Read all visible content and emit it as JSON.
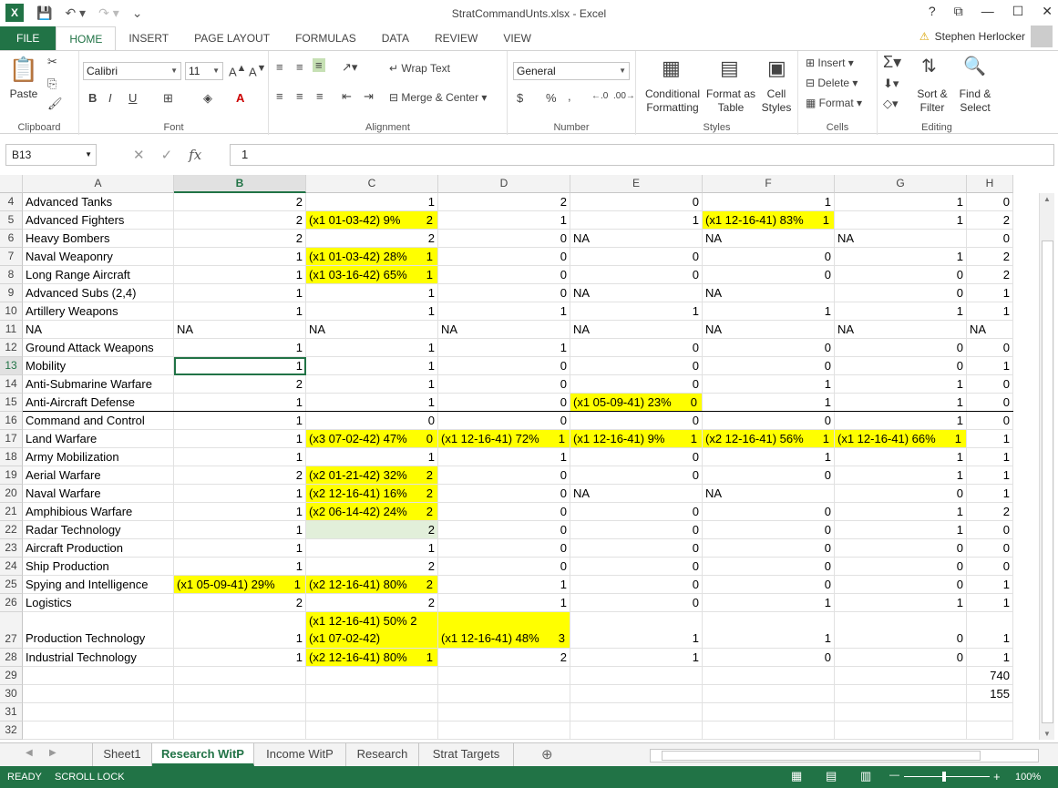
{
  "app": {
    "title": "StratCommandUnts.xlsx - Excel",
    "logo": "X",
    "user": "Stephen Herlocker",
    "window_buttons": [
      "?",
      "⧉",
      "—",
      "☐",
      "✕"
    ]
  },
  "ribbon_tabs": [
    "FILE",
    "HOME",
    "INSERT",
    "PAGE LAYOUT",
    "FORMULAS",
    "DATA",
    "REVIEW",
    "VIEW"
  ],
  "ribbon": {
    "clipboard": {
      "paste": "Paste",
      "label": "Clipboard"
    },
    "font": {
      "name": "Calibri",
      "size": "11",
      "label": "Font",
      "bold": "B",
      "italic": "I",
      "underline": "U"
    },
    "alignment": {
      "wrap": "Wrap Text",
      "merge": "Merge & Center",
      "label": "Alignment"
    },
    "number": {
      "format": "General",
      "label": "Number",
      "currency": "$",
      "percent": "%",
      "comma": ","
    },
    "styles": {
      "conditional": "Conditional Formatting",
      "format_table": "Format as Table",
      "cell_styles": "Cell Styles",
      "label": "Styles"
    },
    "cells": {
      "insert": "Insert",
      "delete": "Delete",
      "format": "Format",
      "label": "Cells"
    },
    "editing": {
      "sort": "Sort & Filter",
      "find": "Find & Select",
      "label": "Editing"
    }
  },
  "formula_bar": {
    "name_box": "B13",
    "fx": "fx",
    "value": "1"
  },
  "columns": [
    "A",
    "B",
    "C",
    "D",
    "E",
    "F",
    "G",
    "H"
  ],
  "selected_column": "B",
  "selected_row": "13",
  "rows": [
    {
      "n": "4",
      "A": "Advanced Tanks",
      "B": "2",
      "C": "1",
      "D": "2",
      "E": "0",
      "F": "1",
      "G": "1",
      "H": "0"
    },
    {
      "n": "5",
      "A": "Advanced Fighters",
      "B": "2",
      "C": "(x1 01-03-42)    9%    2",
      "D": "1",
      "E": "1",
      "F": "(x1 12-16-41)   83%    1",
      "G": "1",
      "H": "2"
    },
    {
      "n": "6",
      "A": "Heavy Bombers",
      "B": "2",
      "C": "2",
      "D": "0",
      "E": "NA",
      "F": "NA",
      "G": "NA",
      "H": "0"
    },
    {
      "n": "7",
      "A": "Naval Weaponry",
      "B": "1",
      "C": "(x1 01-03-42)   28%    1",
      "D": "0",
      "E": "0",
      "F": "0",
      "G": "1",
      "H": "2"
    },
    {
      "n": "8",
      "A": "Long Range Aircraft",
      "B": "1",
      "C": "(x1 03-16-42)   65%    1",
      "D": "0",
      "E": "0",
      "F": "0",
      "G": "0",
      "H": "2"
    },
    {
      "n": "9",
      "A": "Advanced Subs (2,4)",
      "B": "1",
      "C": "1",
      "D": "0",
      "E": "NA",
      "F": "NA",
      "G": "0",
      "H": "1"
    },
    {
      "n": "10",
      "A": "Artillery Weapons",
      "B": "1",
      "C": "1",
      "D": "1",
      "E": "1",
      "F": "1",
      "G": "1",
      "H": "1"
    },
    {
      "n": "11",
      "A": "NA",
      "B": "NA",
      "C": "NA",
      "D": "NA",
      "E": "NA",
      "F": "NA",
      "G": "NA",
      "H": "NA"
    },
    {
      "n": "12",
      "A": "Ground Attack Weapons",
      "B": "1",
      "C": "1",
      "D": "1",
      "E": "0",
      "F": "0",
      "G": "0",
      "H": "0"
    },
    {
      "n": "13",
      "A": "Mobility",
      "B": "1",
      "C": "1",
      "D": "0",
      "E": "0",
      "F": "0",
      "G": "0",
      "H": "1"
    },
    {
      "n": "14",
      "A": "Anti-Submarine Warfare",
      "B": "2",
      "C": "1",
      "D": "0",
      "E": "0",
      "F": "1",
      "G": "1",
      "H": "0"
    },
    {
      "n": "15",
      "A": "Anti-Aircraft Defense",
      "B": "1",
      "C": "1",
      "D": "0",
      "E": "(x1 05-09-41)    23%    0",
      "F": "1",
      "G": "1",
      "H": "0"
    },
    {
      "n": "16",
      "A": "Command and Control",
      "B": "1",
      "C": "0",
      "D": "0",
      "E": "0",
      "F": "0",
      "G": "1",
      "H": "0"
    },
    {
      "n": "17",
      "A": "Land Warfare",
      "B": "1",
      "C": "(x3 07-02-42)   47%    0",
      "D": "(x1 12-16-41)   72%    1",
      "E": "(x1 12-16-41)         9%    1",
      "F": "(x2 12-16-41)   56%    1",
      "G": "(x1 12-16-41)   66%    1",
      "H": "1"
    },
    {
      "n": "18",
      "A": "Army Mobilization",
      "B": "1",
      "C": "1",
      "D": "1",
      "E": "0",
      "F": "1",
      "G": "1",
      "H": "1"
    },
    {
      "n": "19",
      "A": "Aerial Warfare",
      "B": "2",
      "C": "(x2 01-21-42)  32%       2",
      "D": "0",
      "E": "0",
      "F": "0",
      "G": "1",
      "H": "1"
    },
    {
      "n": "20",
      "A": "Naval Warfare",
      "B": "1",
      "C": "(x2 12-16-41)  16%       2",
      "D": "0",
      "E": "NA",
      "F": "NA",
      "G": "0",
      "H": "1"
    },
    {
      "n": "21",
      "A": "Amphibious Warfare",
      "B": "1",
      "C": "(x2 06-14-42)   24%     2",
      "D": "0",
      "E": "0",
      "F": "0",
      "G": "1",
      "H": "2"
    },
    {
      "n": "22",
      "A": "Radar Technology",
      "B": "1",
      "C": "2",
      "D": "0",
      "E": "0",
      "F": "0",
      "G": "1",
      "H": "0"
    },
    {
      "n": "23",
      "A": "Aircraft Production",
      "B": "1",
      "C": "1",
      "D": "0",
      "E": "0",
      "F": "0",
      "G": "0",
      "H": "0"
    },
    {
      "n": "24",
      "A": "Ship Production",
      "B": "1",
      "C": "2",
      "D": "0",
      "E": "0",
      "F": "0",
      "G": "0",
      "H": "0"
    },
    {
      "n": "25",
      "A": "Spying and Intelligence",
      "B": "(x1 05-09-41)      29%    1",
      "C": "(x2 12-16-41)      80%    2",
      "D": "1",
      "E": "0",
      "F": "0",
      "G": "0",
      "H": "1"
    },
    {
      "n": "26",
      "A": "Logistics",
      "B": "2",
      "C": "2",
      "D": "1",
      "E": "0",
      "F": "1",
      "G": "1",
      "H": "1"
    },
    {
      "n": "27",
      "A": "Production Technology",
      "B": "1",
      "C": "(x1 12-16-41)   50%    2",
      "C2": "(x1 07-02-42)",
      "D": "(x1 12-16-41)   48%     3",
      "E": "1",
      "F": "1",
      "G": "0",
      "H": "1"
    },
    {
      "n": "28",
      "A": "Industrial Technology",
      "B": "1",
      "C": "(x2 12-16-41)   80%      1",
      "D": "2",
      "E": "1",
      "F": "0",
      "G": "0",
      "H": "1"
    },
    {
      "n": "29",
      "A": "",
      "B": "",
      "C": "",
      "D": "",
      "E": "",
      "F": "",
      "G": "",
      "H": "740"
    },
    {
      "n": "30",
      "A": "",
      "B": "",
      "C": "",
      "D": "",
      "E": "",
      "F": "",
      "G": "",
      "H": "155"
    },
    {
      "n": "31",
      "A": "",
      "B": "",
      "C": "",
      "D": "",
      "E": "",
      "F": "",
      "G": "",
      "H": ""
    },
    {
      "n": "32",
      "A": "",
      "B": "",
      "C": "",
      "D": "",
      "E": "",
      "F": "",
      "G": "",
      "H": ""
    }
  ],
  "sheet_tabs": [
    "Sheet1",
    "Research WitP",
    "Income WitP",
    "Research",
    "Strat Targets"
  ],
  "active_sheet": "Research WitP",
  "status": {
    "ready": "READY",
    "scroll_lock": "SCROLL LOCK",
    "zoom": "100%"
  },
  "colors": {
    "accent": "#217346",
    "highlight": "#ffff00",
    "pale_green": "#e2efda"
  }
}
